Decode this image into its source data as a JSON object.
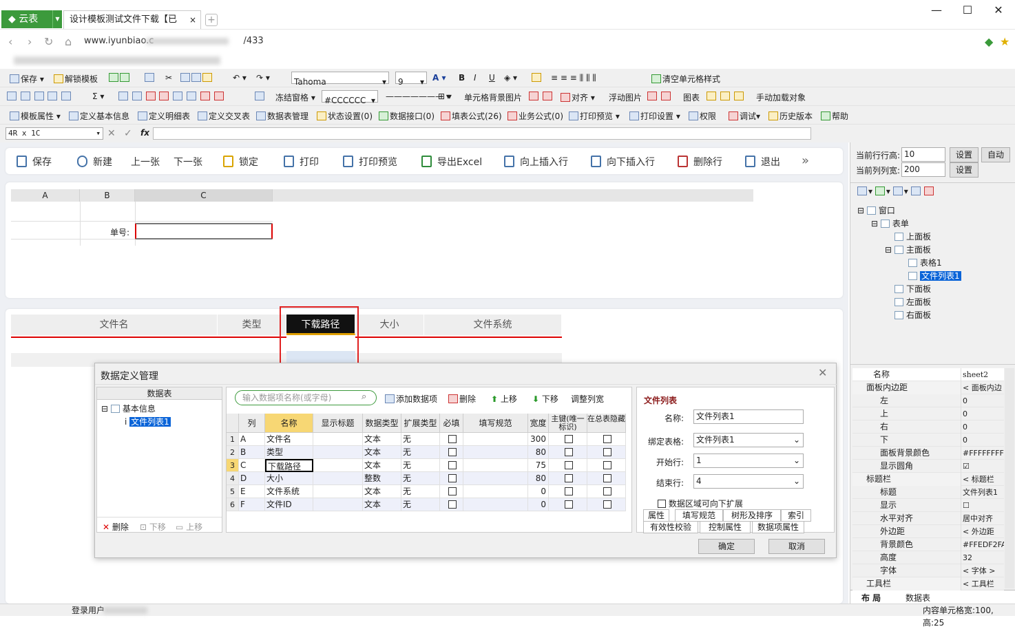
{
  "browser": {
    "brand": "云表",
    "tab_title": "设计模板测试文件下载【已",
    "url": "www.iyunbiao.c",
    "url_tail": "/433"
  },
  "toolbar1": {
    "save": "保存",
    "unlock": "解锁模板",
    "font": "Tahoma",
    "size": "9",
    "clear_style": "清空单元格样式"
  },
  "toolbar2": {
    "freeze": "冻结窗格",
    "color": "#CCCCCC",
    "bg_image": "单元格背景图片",
    "align": "对齐",
    "float_image": "浮动图片",
    "chart": "图表",
    "manual_load": "手动加载对象"
  },
  "toolbar3": {
    "items": [
      "模板属性",
      "定义基本信息",
      "定义明细表",
      "定义交叉表",
      "数据表管理",
      "状态设置(0)",
      "数据接口(0)",
      "填表公式(26)",
      "业务公式(0)",
      "打印预览",
      "打印设置",
      "权限",
      "调试",
      "历史版本",
      "帮助"
    ]
  },
  "formula": {
    "cell": "4R x 1C"
  },
  "actions": [
    "保存",
    "新建",
    "上一张",
    "下一张",
    "锁定",
    "打印",
    "打印预览",
    "导出Excel",
    "向上插入行",
    "向下插入行",
    "删除行",
    "退出"
  ],
  "sheet": {
    "cols": [
      "A",
      "B",
      "C"
    ],
    "label": "单号:"
  },
  "filelist": {
    "headers": [
      "文件名",
      "类型",
      "下载路径",
      "大小",
      "文件系统"
    ]
  },
  "rightpanel": {
    "row_height_label": "当前行行高:",
    "row_height": "10",
    "col_width_label": "当前列列宽:",
    "col_width": "200",
    "set": "设置",
    "auto": "自动",
    "tree": [
      "窗口",
      "表单",
      "上面板",
      "主面板",
      "表格1",
      "文件列表1",
      "下面板",
      "左面板",
      "右面板"
    ],
    "props": [
      {
        "k": "名称",
        "v": "sheet2"
      },
      {
        "k": "面板内边距",
        "v": "< 面板内边"
      },
      {
        "k": "左",
        "v": "0"
      },
      {
        "k": "上",
        "v": "0"
      },
      {
        "k": "右",
        "v": "0"
      },
      {
        "k": "下",
        "v": "0"
      },
      {
        "k": "面板背景颜色",
        "v": "#FFFFFFFF"
      },
      {
        "k": "显示圆角",
        "v": "☑"
      },
      {
        "k": "标题栏",
        "v": "< 标题栏"
      },
      {
        "k": "标题",
        "v": "文件列表1"
      },
      {
        "k": "显示",
        "v": "☐"
      },
      {
        "k": "水平对齐",
        "v": "居中对齐"
      },
      {
        "k": "外边距",
        "v": "< 外边距"
      },
      {
        "k": "背景颜色",
        "v": "#FFEDF2FA"
      },
      {
        "k": "高度",
        "v": "32"
      },
      {
        "k": "字体",
        "v": "< 字体 >"
      },
      {
        "k": "工具栏",
        "v": "< 工具栏"
      }
    ],
    "bottom_tabs": [
      "布 局",
      "数据表"
    ]
  },
  "dialog": {
    "title": "数据定义管理",
    "left_header": "数据表",
    "tree_root": "基本信息",
    "tree_child": "文件列表1",
    "left_btns": [
      "删除",
      "下移",
      "上移"
    ],
    "search_placeholder": "输入数据项名称(或字母)",
    "tools": [
      "添加数据项",
      "删除",
      "上移",
      "下移",
      "调整列宽"
    ],
    "headers": [
      "列",
      "名称",
      "显示标题",
      "数据类型",
      "扩展类型",
      "必填",
      "填写规范",
      "宽度",
      "主键(唯一标识)",
      "在总表隐藏"
    ],
    "rows": [
      {
        "n": "1",
        "col": "A",
        "name": "文件名",
        "type": "文本",
        "ext": "无",
        "width": "300"
      },
      {
        "n": "2",
        "col": "B",
        "name": "类型",
        "type": "文本",
        "ext": "无",
        "width": "80"
      },
      {
        "n": "3",
        "col": "C",
        "name": "下载路径",
        "type": "文本",
        "ext": "无",
        "width": "75"
      },
      {
        "n": "4",
        "col": "D",
        "name": "大小",
        "type": "整数",
        "ext": "无",
        "width": "80"
      },
      {
        "n": "5",
        "col": "E",
        "name": "文件系统",
        "type": "文本",
        "ext": "无",
        "width": "0"
      },
      {
        "n": "6",
        "col": "F",
        "name": "文件ID",
        "type": "文本",
        "ext": "无",
        "width": "0"
      }
    ],
    "props_title": "文件列表",
    "name_label": "名称:",
    "name_value": "文件列表1",
    "bind_label": "绑定表格:",
    "bind_value": "文件列表1",
    "start_label": "开始行:",
    "start_value": "1",
    "end_label": "结束行:",
    "end_value": "4",
    "expand_label": "数据区域可向下扩展",
    "tabs1": [
      "属性",
      "填写规范",
      "树形及排序",
      "索引"
    ],
    "tabs2": [
      "有效性校验",
      "控制属性",
      "数据项属性"
    ],
    "ok": "确定",
    "cancel": "取消"
  },
  "status": {
    "login": "登录用户",
    "cellinfo": "内容单元格宽:100, 高:25"
  }
}
